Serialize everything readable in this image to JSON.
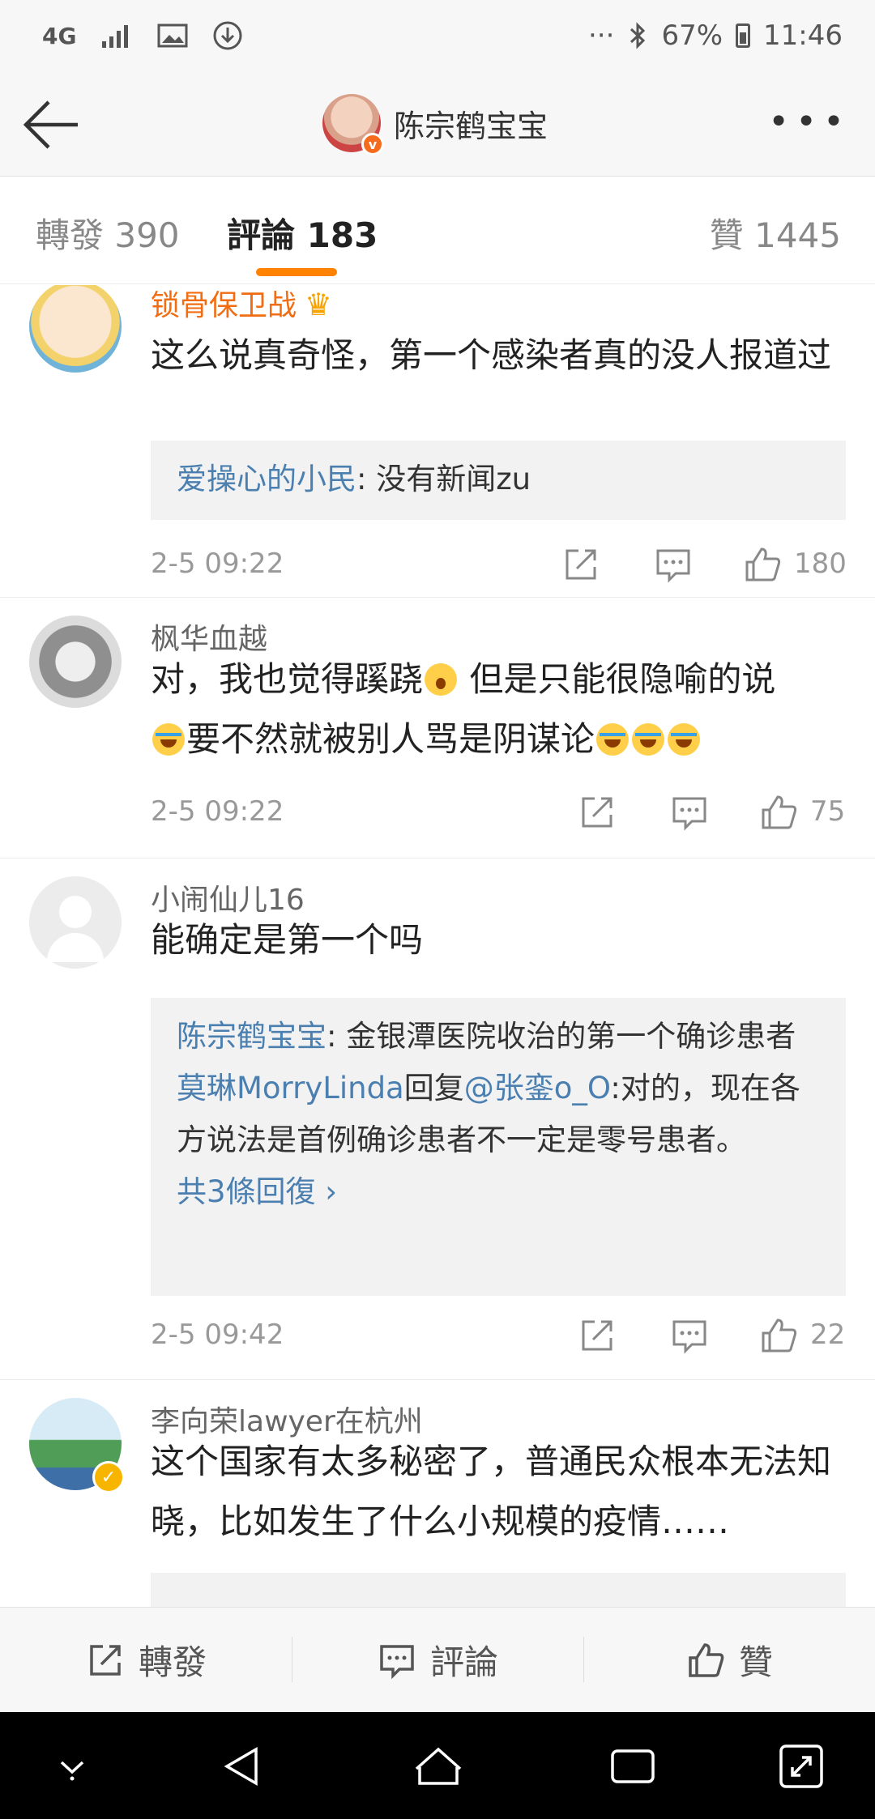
{
  "status_bar": {
    "network": "4G",
    "dots": "···",
    "battery": "67%",
    "time": "11:46"
  },
  "nav": {
    "title": "陈宗鹤宝宝"
  },
  "tabs": {
    "repost": "轉發 390",
    "comment": "評論 183",
    "like": "贊 1445"
  },
  "comments": [
    {
      "user": "锁骨保卫战",
      "text": "这么说真奇怪，第一个感染者真的没人报道过",
      "reply": {
        "user": "爱操心的小民",
        "text": ": 没有新闻zu"
      },
      "time": "2-5 09:22",
      "likes": "180"
    },
    {
      "user": "枫华血越",
      "text_a": "对，我也觉得蹊跷",
      "text_b": " 但是只能很隐喻的说",
      "text_c": "要不然就被别人骂是阴谋论",
      "time": "2-5 09:22",
      "likes": "75"
    },
    {
      "user": "小闹仙儿16",
      "text": "能确定是第一个吗",
      "reply": {
        "user1": "陈宗鹤宝宝",
        "text1": ": 金银潭医院收治的第一个确诊患者",
        "user2": "莫琳MorryLinda",
        "mid2": "回复",
        "mention2": "@张銮o_O",
        "text2": ":对的，现在各方说法是首例确诊患者不一定是零号患者。",
        "more": "共3條回復 ›"
      },
      "time": "2-5 09:42",
      "likes": "22"
    },
    {
      "user": "李向荣lawyer在杭州",
      "text": "这个国家有太多秘密了，普通民众根本无法知晓，比如发生了什么小规模的疫情……"
    }
  ],
  "bottom_bar": {
    "repost": "轉發",
    "comment": "評論",
    "like": "贊"
  },
  "colors": {
    "accent": "#ff8200",
    "link": "#4a7fb0",
    "vip_name": "#f26d11"
  }
}
